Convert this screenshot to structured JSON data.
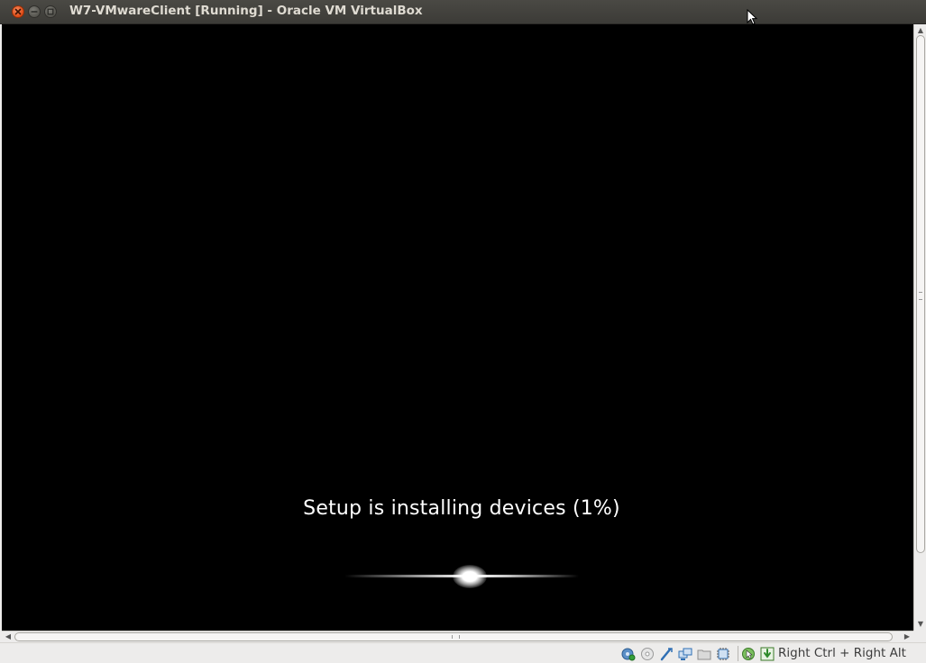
{
  "window": {
    "title": "W7-VMwareClient [Running] - Oracle VM VirtualBox",
    "controls": {
      "close_icon": "close-icon",
      "minimize_icon": "minimize-icon",
      "maximize_icon": "maximize-icon"
    }
  },
  "vm_display": {
    "status_text": "Setup is installing devices (1%)",
    "progress_percent": 1,
    "background_color": "#000000",
    "text_color": "#ffffff"
  },
  "statusbar": {
    "indicators": [
      {
        "icon": "hard-disk-icon"
      },
      {
        "icon": "optical-drive-icon"
      },
      {
        "icon": "usb-icon"
      },
      {
        "icon": "network-icon"
      },
      {
        "icon": "shared-folders-icon"
      },
      {
        "icon": "video-capture-icon"
      },
      {
        "icon": "mouse-integration-icon"
      },
      {
        "icon": "keyboard-capture-icon"
      }
    ],
    "host_key": "Right Ctrl + Right Alt"
  },
  "colors": {
    "titlebar": "#3c3b37",
    "title_text": "#dfdbd2",
    "close_button": "#df4a15",
    "chrome": "#edeceb"
  }
}
